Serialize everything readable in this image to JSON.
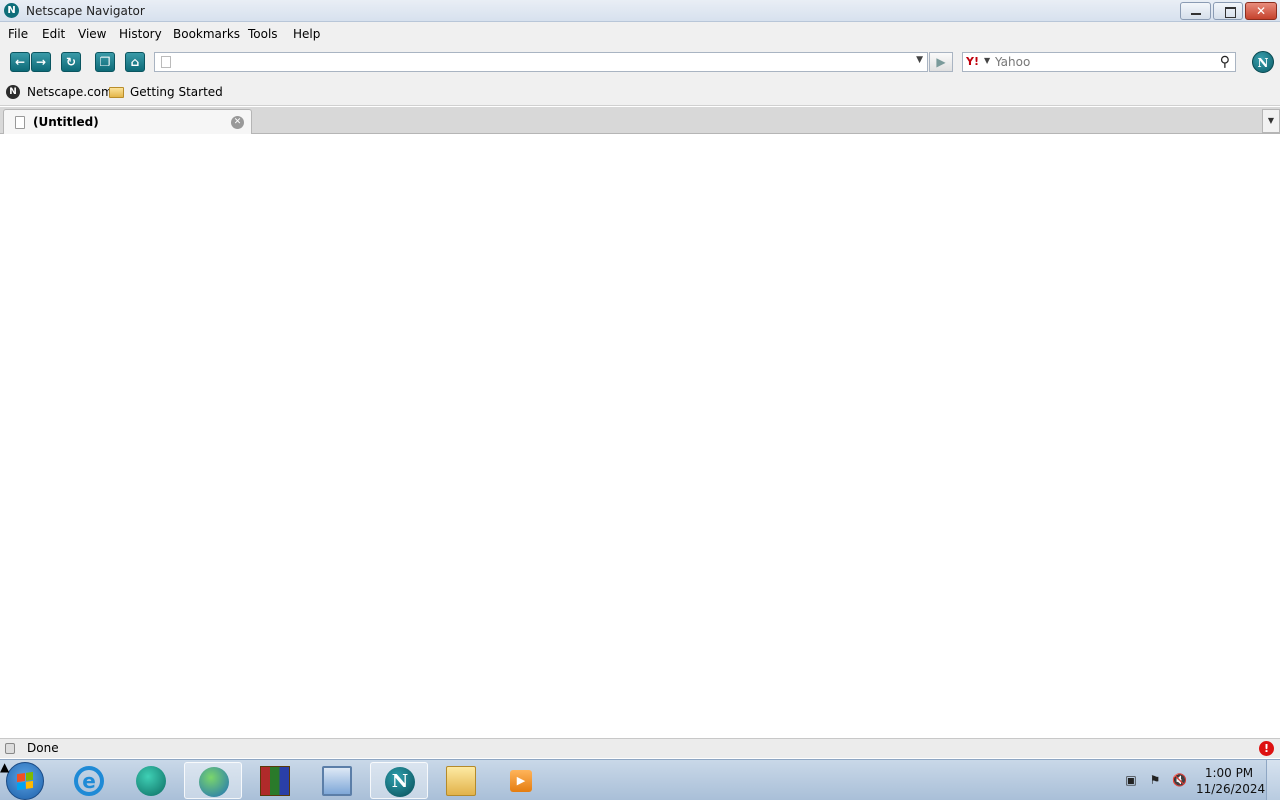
{
  "window": {
    "title": "Netscape Navigator",
    "app_icon": "netscape-icon"
  },
  "menu": [
    "File",
    "Edit",
    "View",
    "History",
    "Bookmarks",
    "Tools",
    "Help"
  ],
  "toolbar": {
    "back_icon": "back-arrow-icon",
    "forward_icon": "forward-arrow-icon",
    "reload_icon": "reload-icon",
    "tabs_icon": "new-tab-icon",
    "home_icon": "home-icon",
    "url_value": "",
    "go_icon": "go-arrow-icon"
  },
  "search": {
    "engine_icon": "yahoo-icon",
    "placeholder": "Yahoo"
  },
  "bookmarks": [
    {
      "label": "Netscape.com",
      "icon": "netscape-icon"
    },
    {
      "label": "Getting Started",
      "icon": "folder-icon"
    }
  ],
  "tabs": [
    {
      "label": "(Untitled)"
    }
  ],
  "status": {
    "text": "Done"
  },
  "taskbar": {
    "clock_time": "1:00 PM",
    "clock_date": "11/26/2024",
    "apps": [
      "internet-explorer-icon",
      "messenger-icon",
      "globe-download-icon",
      "winrar-icon",
      "computer-icon",
      "netscape-icon",
      "folder-icon",
      "media-player-icon"
    ]
  },
  "colors": {
    "accent": "#0d6a77",
    "alert": "#dd1111"
  }
}
